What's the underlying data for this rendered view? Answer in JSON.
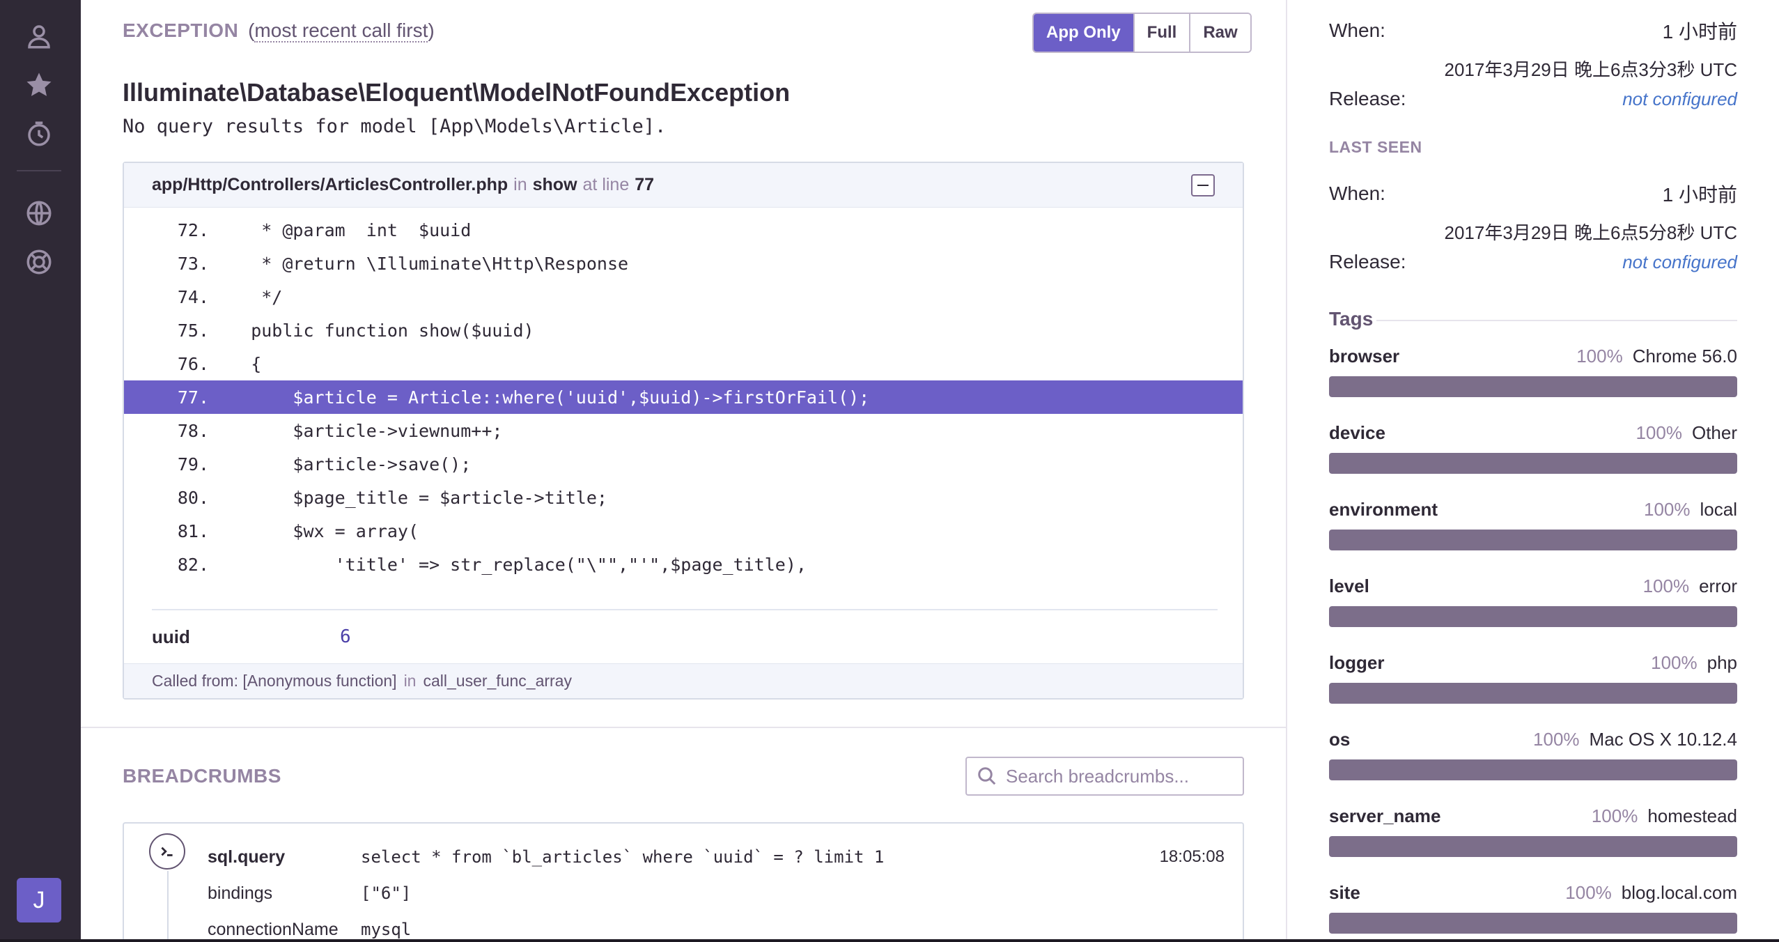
{
  "colors": {
    "sidebar_bg": "#2f2936",
    "accent": "#6c5fc7",
    "muted": "#9585a3",
    "link": "#4674ca",
    "tag_bar": "#7c6e8a"
  },
  "sidebar": {
    "icons": [
      "user-icon",
      "star-icon",
      "activity-clock-icon",
      "globe-icon",
      "lifebuoy-icon"
    ],
    "avatar_letter": "J"
  },
  "exception": {
    "section_title": "EXCEPTION",
    "order_prefix": "(",
    "order_link": "most recent call first",
    "order_suffix": ")",
    "view_buttons": [
      "App Only",
      "Full",
      "Raw"
    ],
    "active_view": "App Only",
    "type": "Illuminate\\Database\\Eloquent\\ModelNotFoundException",
    "message": "No query results for model [App\\Models\\Article]."
  },
  "frame": {
    "filename": "app/Http/Controllers/ArticlesController.php",
    "in_word": "in",
    "function": "show",
    "at_line_word": "at line",
    "line": "77",
    "code_lines": [
      {
        "no": "72.",
        "text": "     * @param  int  $uuid"
      },
      {
        "no": "73.",
        "text": "     * @return \\Illuminate\\Http\\Response"
      },
      {
        "no": "74.",
        "text": "     */"
      },
      {
        "no": "75.",
        "text": "    public function show($uuid)"
      },
      {
        "no": "76.",
        "text": "    {"
      },
      {
        "no": "77.",
        "text": "        $article = Article::where('uuid',$uuid)->firstOrFail();"
      },
      {
        "no": "78.",
        "text": "        $article->viewnum++;"
      },
      {
        "no": "79.",
        "text": "        $article->save();"
      },
      {
        "no": "80.",
        "text": "        $page_title = $article->title;"
      },
      {
        "no": "81.",
        "text": "        $wx = array("
      },
      {
        "no": "82.",
        "text": "            'title' => str_replace(\"\\\"\",\"'\",$page_title),"
      }
    ],
    "highlight_line": "77.",
    "var_key": "uuid",
    "var_value": "6",
    "called_from_label": "Called from:",
    "called_from_fn": "[Anonymous function]",
    "called_in_word": "in",
    "called_from_target": "call_user_func_array"
  },
  "breadcrumbs": {
    "title": "BREADCRUMBS",
    "search_placeholder": "Search breadcrumbs...",
    "entry": {
      "category": "sql.query",
      "message": "select * from `bl_articles` where `uuid` = ? limit 1",
      "time": "18:05:08",
      "bindings_label": "bindings",
      "bindings_value": "[\"6\"]",
      "connection_label": "connectionName",
      "connection_value": "mysql"
    }
  },
  "first_seen": {
    "when_label": "When:",
    "when_value": "1 小时前",
    "when_detail": "2017年3月29日 晚上6点3分3秒 UTC",
    "release_label": "Release:",
    "release_value": "not configured"
  },
  "last_seen": {
    "title": "LAST SEEN",
    "when_label": "When:",
    "when_value": "1 小时前",
    "when_detail": "2017年3月29日 晚上6点5分8秒 UTC",
    "release_label": "Release:",
    "release_value": "not configured"
  },
  "tags": {
    "title": "Tags",
    "items": [
      {
        "key": "browser",
        "pct": "100%",
        "value": "Chrome 56.0",
        "fraction": 1.0
      },
      {
        "key": "device",
        "pct": "100%",
        "value": "Other",
        "fraction": 1.0
      },
      {
        "key": "environment",
        "pct": "100%",
        "value": "local",
        "fraction": 1.0
      },
      {
        "key": "level",
        "pct": "100%",
        "value": "error",
        "fraction": 1.0
      },
      {
        "key": "logger",
        "pct": "100%",
        "value": "php",
        "fraction": 1.0
      },
      {
        "key": "os",
        "pct": "100%",
        "value": "Mac OS X 10.12.4",
        "fraction": 1.0
      },
      {
        "key": "server_name",
        "pct": "100%",
        "value": "homestead",
        "fraction": 1.0
      },
      {
        "key": "site",
        "pct": "100%",
        "value": "blog.local.com",
        "fraction": 1.0
      }
    ]
  }
}
